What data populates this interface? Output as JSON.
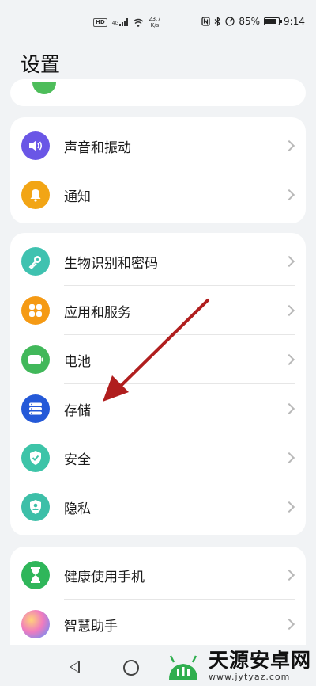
{
  "status_bar": {
    "hd": "HD",
    "network": "4G",
    "speed_value": "23.7",
    "speed_unit": "K/s",
    "battery": "85%",
    "time": "9:14",
    "battery_level": 0.85
  },
  "page": {
    "title": "设置"
  },
  "groups": [
    {
      "items": [
        {
          "label": "声音和振动",
          "icon": "speaker-icon",
          "color": "#6a56e6"
        },
        {
          "label": "通知",
          "icon": "bell-icon",
          "color": "#f2a515"
        }
      ]
    },
    {
      "items": [
        {
          "label": "生物识别和密码",
          "icon": "key-icon",
          "color": "#3fc2b0"
        },
        {
          "label": "应用和服务",
          "icon": "apps-grid-icon",
          "color": "#f59a14"
        },
        {
          "label": "电池",
          "icon": "battery-icon",
          "color": "#41b85a"
        },
        {
          "label": "存储",
          "icon": "storage-icon",
          "color": "#2459d8"
        },
        {
          "label": "安全",
          "icon": "shield-check-icon",
          "color": "#3dc4a8"
        },
        {
          "label": "隐私",
          "icon": "privacy-shield-icon",
          "color": "#3dbfa8"
        }
      ]
    },
    {
      "items": [
        {
          "label": "健康使用手机",
          "icon": "hourglass-icon",
          "color": "#2fb65a"
        },
        {
          "label": "智慧助手",
          "icon": "assistant-orb-icon",
          "color": "#e07ad0"
        }
      ]
    }
  ],
  "watermark": {
    "name": "天源安卓网",
    "url": "www.jytyaz.com"
  },
  "annotation": {
    "color": "#b01e1e"
  }
}
